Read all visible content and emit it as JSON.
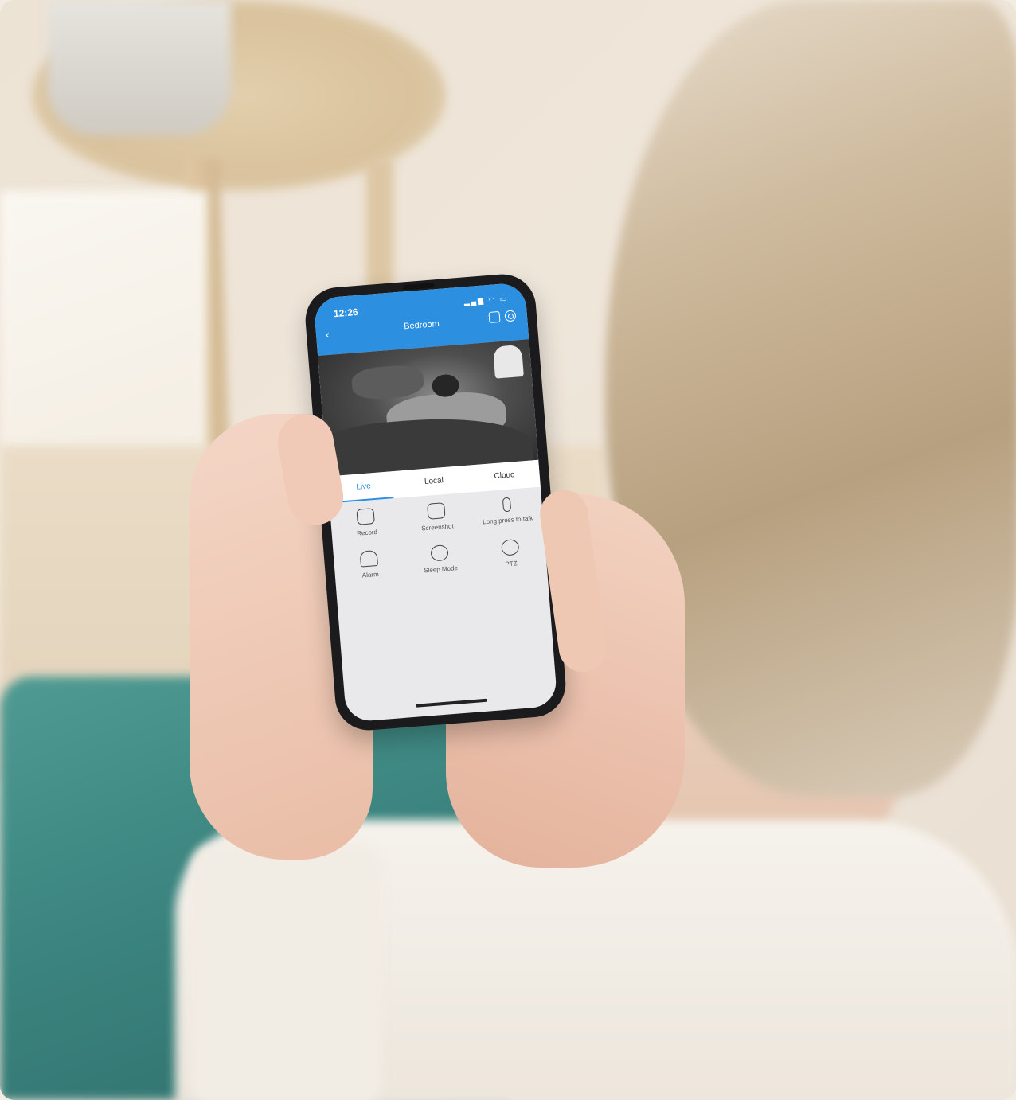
{
  "phone": {
    "status_time": "12:26",
    "header_title": "Bedroom",
    "back_icon": "chevron-left-icon",
    "header_icons": [
      "message-icon",
      "gear-icon"
    ],
    "tabs": [
      {
        "label": "Live",
        "active": true
      },
      {
        "label": "Local",
        "active": false
      },
      {
        "label": "Clouc",
        "active": false
      }
    ],
    "controls": [
      {
        "label": "Record",
        "icon": "video-record-icon"
      },
      {
        "label": "Screenshot",
        "icon": "camera-icon"
      },
      {
        "label": "Long press to talk",
        "icon": "microphone-icon"
      },
      {
        "label": "Alarm",
        "icon": "bell-icon"
      },
      {
        "label": "Sleep Mode",
        "icon": "moon-icon"
      },
      {
        "label": "PTZ",
        "icon": "ptz-icon"
      }
    ],
    "accent_color": "#2c8fe0"
  }
}
